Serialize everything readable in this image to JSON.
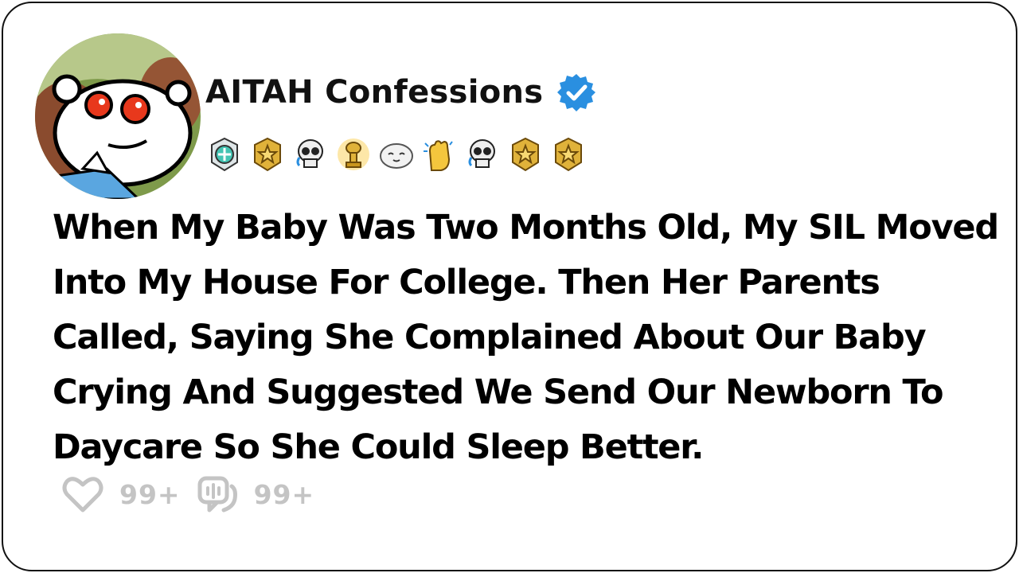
{
  "post": {
    "author": "AITAH Confessions",
    "verified_icon": "verified-badge-icon",
    "title": "When My Baby Was Two Months Old, My SIL Moved Into My House For College. Then Her Parents Called, Saying She Complained About Our Baby Crying And Suggested We Send Our Newborn To Daycare So She Could Sleep Better.",
    "likes": "99+",
    "comments": "99+"
  },
  "badges": [
    "helpful-award-icon",
    "gold-award-icon",
    "skull-award-icon",
    "trophy-award-icon",
    "wholesome-award-icon",
    "clapping-award-icon",
    "skull-award-icon",
    "gold-award-icon",
    "gold-award-icon"
  ],
  "colors": {
    "verified": "#2a8fe0",
    "gold": "#e0b23a",
    "stat_gray": "#c4c4c4"
  }
}
